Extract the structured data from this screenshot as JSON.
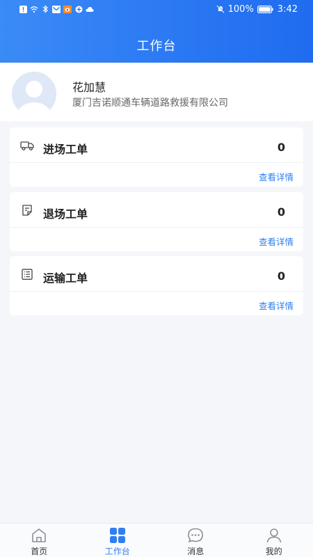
{
  "status_bar": {
    "battery": "100%",
    "time": "3:42"
  },
  "header": {
    "title": "工作台"
  },
  "profile": {
    "name": "花加慧",
    "company": "厦门吉诺顺通车辆道路救援有限公司"
  },
  "cards": [
    {
      "label": "进场工单",
      "count": "0",
      "link": "查看详情",
      "icon": "truck-icon"
    },
    {
      "label": "退场工单",
      "count": "0",
      "link": "查看详情",
      "icon": "note-icon"
    },
    {
      "label": "运输工单",
      "count": "0",
      "link": "查看详情",
      "icon": "list-icon"
    }
  ],
  "tabbar": {
    "items": [
      {
        "label": "首页",
        "icon": "home-icon",
        "active": false
      },
      {
        "label": "工作台",
        "icon": "grid-icon",
        "active": true
      },
      {
        "label": "消息",
        "icon": "chat-icon",
        "active": false
      },
      {
        "label": "我的",
        "icon": "user-icon",
        "active": false
      }
    ]
  },
  "colors": {
    "accent": "#2f7ff2",
    "header_start": "#3b8bf6",
    "header_end": "#1f6cf0",
    "background": "#f4f6fa"
  }
}
